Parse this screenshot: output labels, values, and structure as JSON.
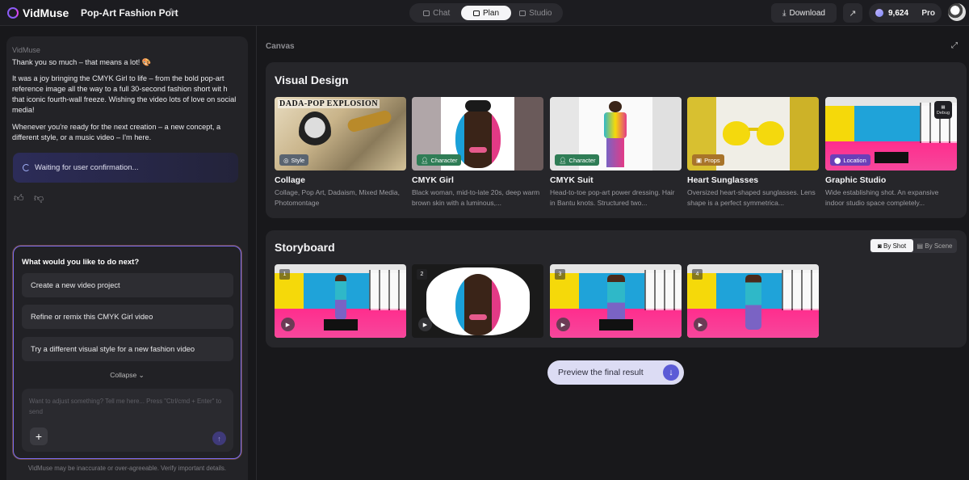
{
  "app": {
    "name": "VidMuse",
    "project_title": "Pop-Art Fashion Port"
  },
  "modes": [
    {
      "label": "Chat",
      "active": false
    },
    {
      "label": "Plan",
      "active": true
    },
    {
      "label": "Studio",
      "active": false
    }
  ],
  "header": {
    "download_label": "Download",
    "credits": "9,624",
    "plan": "Pro"
  },
  "chat": {
    "sender": "VidMuse",
    "messages": [
      "Thank you so much – that means a lot! 🎨",
      "It was a joy bringing the CMYK Girl to life – from the bold pop-art reference image all the way to a full 30-second fashion short wit h that iconic fourth-wall freeze. Wishing the video lots of love on social media!",
      "Whenever you're ready for the next creation – a new concept, a different style, or a music video – I'm here."
    ],
    "status": "Waiting for user confirmation...",
    "next_title": "What would you like to do next?",
    "options": [
      "Create a new video project",
      "Refine or remix this CMYK Girl video",
      "Try a different visual style for a new fashion video"
    ],
    "collapse_label": "Collapse",
    "input_placeholder": "Want to adjust something? Tell me here... Press \"Ctrl/cmd + Enter\" to send",
    "disclaimer": "VidMuse may be inaccurate or over-agreeable. Verify important details."
  },
  "canvas": {
    "label": "Canvas",
    "visual_design": {
      "title": "Visual Design",
      "debug_label": "Debug",
      "cards": [
        {
          "tag": "Style",
          "tag_color": "#5a6470",
          "title": "Collage",
          "desc": "Collage, Pop Art, Dadaism, Mixed Media, Photomontage",
          "overlay": "DADA-POP EXPLOSION"
        },
        {
          "tag": "Character",
          "tag_color": "#2f7d56",
          "title": "CMYK Girl",
          "desc": "Black woman, mid-to-late 20s, deep warm brown skin with a luminous,..."
        },
        {
          "tag": "Character",
          "tag_color": "#2f7d56",
          "title": "CMYK Suit",
          "desc": "Head-to-toe pop-art power dressing. Hair in Bantu knots. Structured two..."
        },
        {
          "tag": "Props",
          "tag_color": "#a8742a",
          "title": "Heart Sunglasses",
          "desc": "Oversized heart-shaped sunglasses. Lens shape is a perfect symmetrica..."
        },
        {
          "tag": "Location",
          "tag_color": "#6b3fb8",
          "title": "Graphic Studio",
          "desc": "Wide establishing shot. An expansive indoor studio space completely..."
        }
      ]
    },
    "storyboard": {
      "title": "Storyboard",
      "toggle": [
        {
          "label": "By Shot",
          "active": true
        },
        {
          "label": "By Scene",
          "active": false
        }
      ],
      "shots": [
        "1",
        "2",
        "3",
        "4"
      ]
    },
    "preview_label": "Preview the final result"
  }
}
